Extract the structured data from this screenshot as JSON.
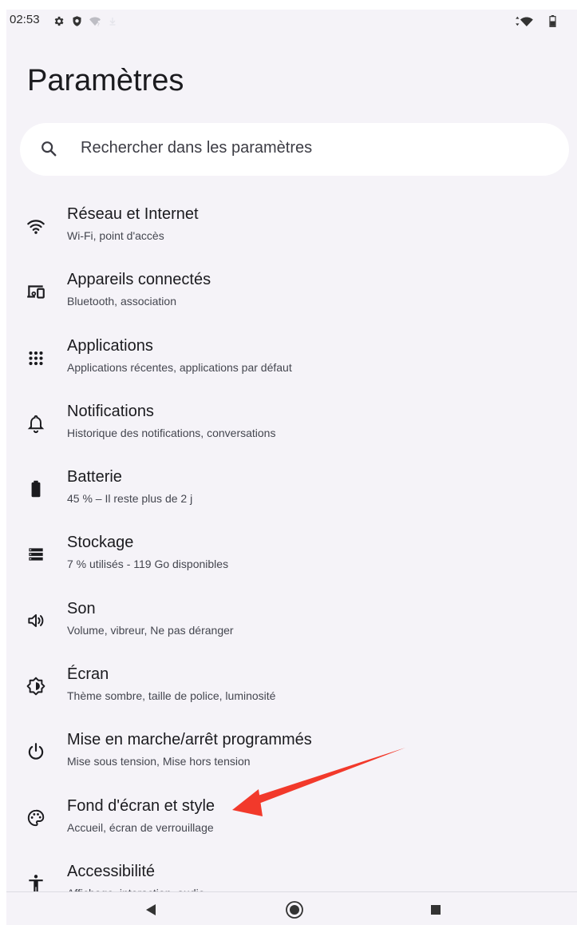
{
  "status_bar": {
    "time": "02:53",
    "icons": [
      "gear-icon",
      "shield-icon",
      "wifi-question-icon",
      "download-icon",
      "signal-icon",
      "battery-icon"
    ]
  },
  "page": {
    "title": "Paramètres"
  },
  "search": {
    "placeholder": "Rechercher dans les paramètres"
  },
  "settings": [
    {
      "title": "Réseau et Internet",
      "subtitle": "Wi-Fi, point d'accès",
      "icon": "wifi-icon"
    },
    {
      "title": "Appareils connectés",
      "subtitle": "Bluetooth, association",
      "icon": "connected-devices-icon"
    },
    {
      "title": "Applications",
      "subtitle": "Applications récentes, applications par défaut",
      "icon": "apps-grid-icon"
    },
    {
      "title": "Notifications",
      "subtitle": "Historique des notifications, conversations",
      "icon": "bell-icon"
    },
    {
      "title": "Batterie",
      "subtitle": "45 % – Il reste plus de 2 j",
      "icon": "battery-icon"
    },
    {
      "title": "Stockage",
      "subtitle": "7 % utilisés - 119 Go disponibles",
      "icon": "storage-icon"
    },
    {
      "title": "Son",
      "subtitle": "Volume, vibreur, Ne pas déranger",
      "icon": "speaker-icon"
    },
    {
      "title": "Écran",
      "subtitle": "Thème sombre, taille de police, luminosité",
      "icon": "brightness-icon"
    },
    {
      "title": "Mise en marche/arrêt programmés",
      "subtitle": "Mise sous tension, Mise hors tension",
      "icon": "power-icon"
    },
    {
      "title": "Fond d'écran et style",
      "subtitle": "Accueil, écran de verrouillage",
      "icon": "palette-icon"
    },
    {
      "title": "Accessibilité",
      "subtitle": "Affichage, interaction, audio",
      "icon": "accessibility-icon"
    }
  ],
  "annotation": {
    "color": "#f2392b",
    "target": "Fond d'écran et style"
  },
  "nav_bar": {
    "icons": [
      "back-icon",
      "home-icon",
      "recents-icon"
    ]
  },
  "colors": {
    "background": "#f5f3f8",
    "search_bg": "#ffffff",
    "text": "#1b1b1f",
    "icon": "#1b1b1f"
  }
}
